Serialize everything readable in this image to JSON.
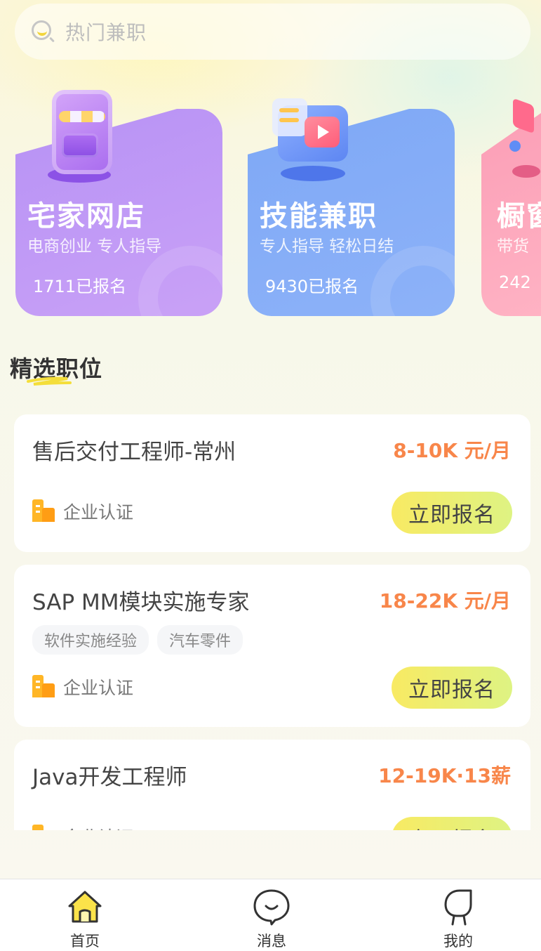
{
  "search": {
    "placeholder": "热门兼职"
  },
  "categories": [
    {
      "title": "宅家网店",
      "subtitle": "电商创业 专人指导",
      "count": "1711已报名"
    },
    {
      "title": "技能兼职",
      "subtitle": "专人指导 轻松日结",
      "count": "9430已报名"
    },
    {
      "title": "橱窗",
      "subtitle": "带货",
      "count": "242"
    }
  ],
  "section": {
    "title": "精选职位"
  },
  "jobs": [
    {
      "title": "售后交付工程师-常州",
      "salary": "8-10K 元/月",
      "tags": [],
      "cert": "企业认证",
      "apply": "立即报名"
    },
    {
      "title": "SAP MM模块实施专家",
      "salary": "18-22K 元/月",
      "tags": [
        "软件实施经验",
        "汽车零件"
      ],
      "cert": "企业认证",
      "apply": "立即报名"
    },
    {
      "title": "Java开发工程师",
      "salary": "12-19K·13薪",
      "tags": [],
      "cert": "企业认证",
      "apply": "立即报名"
    }
  ],
  "tabbar": {
    "home": "首页",
    "messages": "消息",
    "mine": "我的"
  },
  "colors": {
    "accent": "#f8864a",
    "apply_button": "#f8ea63",
    "card1": "#b792f5",
    "card2": "#7ea8f6",
    "card3": "#fb9eb6"
  }
}
